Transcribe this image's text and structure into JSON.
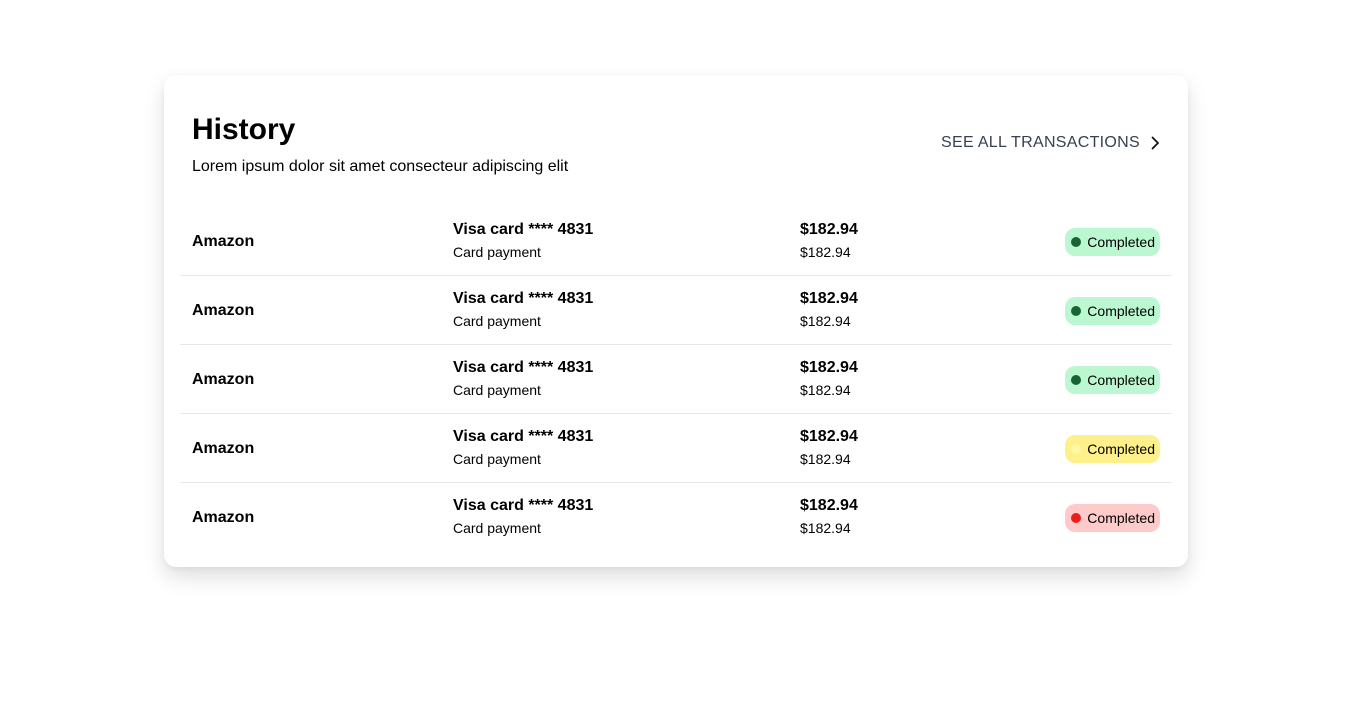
{
  "header": {
    "title": "History",
    "subtitle": "Lorem ipsum dolor sit amet consecteur adipiscing elit",
    "see_all_label": "SEE ALL TRANSACTIONS",
    "see_all_icon": "chevron-right-icon"
  },
  "transactions": [
    {
      "merchant": "Amazon",
      "method": "Visa card **** 4831",
      "type": "Card payment",
      "amount": "$182.94",
      "amount_sub": "$182.94",
      "status": "Completed",
      "status_bg": "#bbf7d0",
      "status_dot": "#166534"
    },
    {
      "merchant": "Amazon",
      "method": "Visa card **** 4831",
      "type": "Card payment",
      "amount": "$182.94",
      "amount_sub": "$182.94",
      "status": "Completed",
      "status_bg": "#bbf7d0",
      "status_dot": "#166534"
    },
    {
      "merchant": "Amazon",
      "method": "Visa card **** 4831",
      "type": "Card payment",
      "amount": "$182.94",
      "amount_sub": "$182.94",
      "status": "Completed",
      "status_bg": "#bbf7d0",
      "status_dot": "#166534"
    },
    {
      "merchant": "Amazon",
      "method": "Visa card **** 4831",
      "type": "Card payment",
      "amount": "$182.94",
      "amount_sub": "$182.94",
      "status": "Completed",
      "status_bg": "#fef08a",
      "status_dot": "#fef9a0"
    },
    {
      "merchant": "Amazon",
      "method": "Visa card **** 4831",
      "type": "Card payment",
      "amount": "$182.94",
      "amount_sub": "$182.94",
      "status": "Completed",
      "status_bg": "#fecaca",
      "status_dot": "#ef1c1c"
    }
  ]
}
